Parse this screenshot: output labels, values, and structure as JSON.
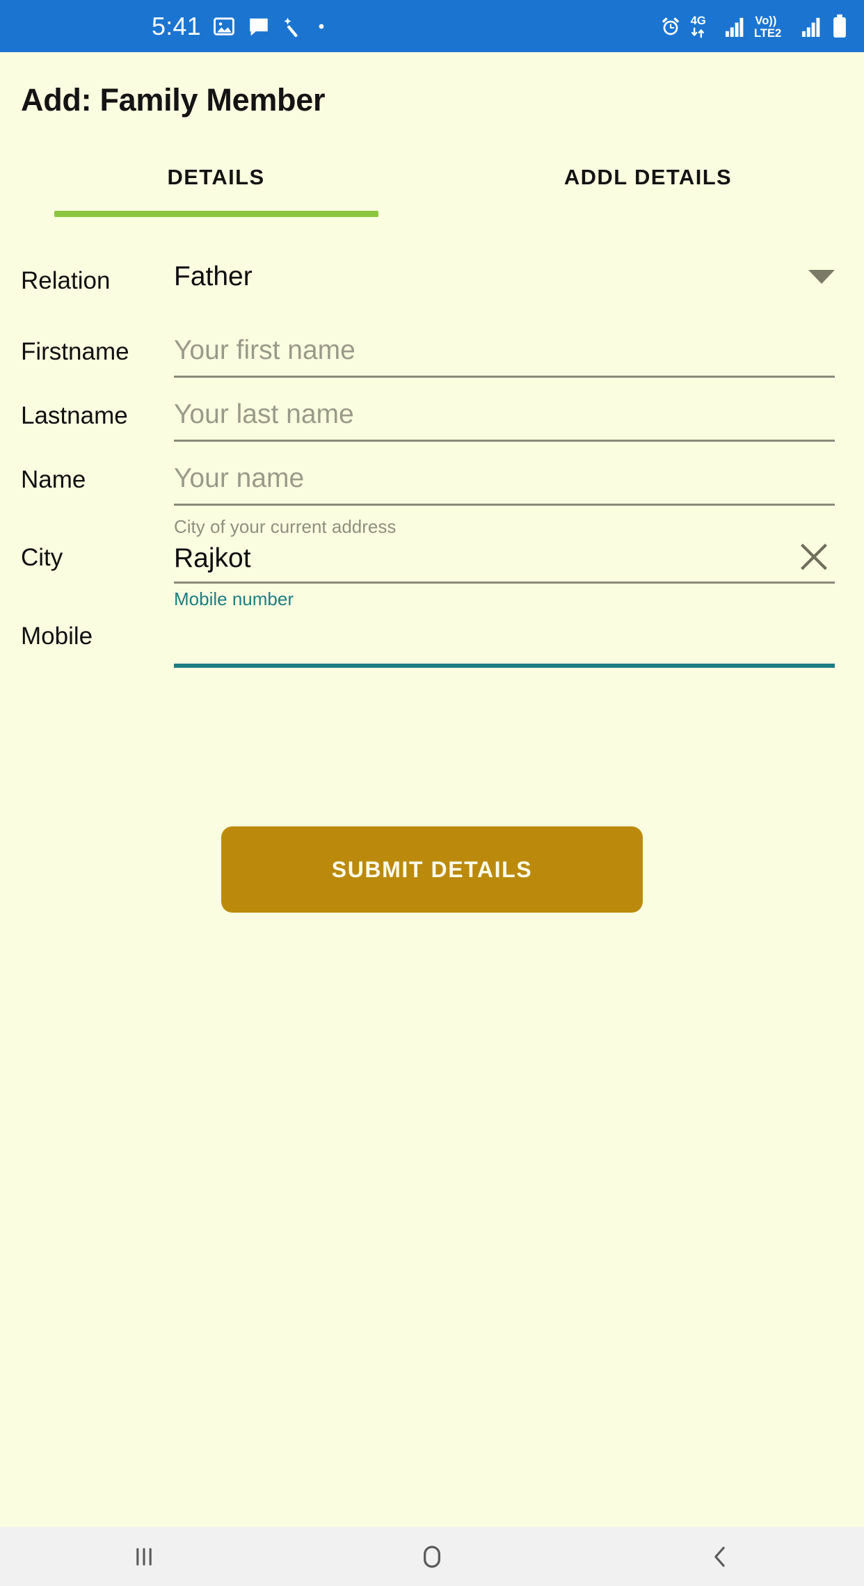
{
  "status_bar": {
    "time": "5:41",
    "background_color": "#1b75d0",
    "left_icons": [
      "image-icon",
      "message-icon",
      "magic-wand-icon",
      "dot-icon"
    ],
    "right_icons": [
      "alarm-icon",
      "network-4g-icon",
      "signal-bars-icon",
      "volte-icon",
      "signal-bars-2-icon",
      "battery-icon"
    ],
    "network_label": "4G",
    "volte_label_top": "Vo))",
    "volte_label_bottom": "LTE2"
  },
  "header": {
    "title": "Add: Family Member"
  },
  "tabs": {
    "active_index": 0,
    "indicator_color": "#8cc63e",
    "items": [
      {
        "label": "DETAILS"
      },
      {
        "label": "ADDL DETAILS"
      }
    ]
  },
  "form": {
    "fields": [
      {
        "label": "Relation",
        "type": "dropdown",
        "value": "Father",
        "helper": "",
        "placeholder": "",
        "focused": false,
        "has_underline": false,
        "has_clear": false
      },
      {
        "label": "Firstname",
        "type": "text",
        "value": "",
        "helper": "",
        "placeholder": "Your first name",
        "focused": false,
        "has_underline": true,
        "has_clear": false
      },
      {
        "label": "Lastname",
        "type": "text",
        "value": "",
        "helper": "",
        "placeholder": "Your last name",
        "focused": false,
        "has_underline": true,
        "has_clear": false
      },
      {
        "label": "Name",
        "type": "text",
        "value": "",
        "helper": "",
        "placeholder": "Your name",
        "focused": false,
        "has_underline": true,
        "has_clear": false
      },
      {
        "label": "City",
        "type": "text",
        "value": "Rajkot",
        "helper": "City of your current address",
        "placeholder": "",
        "focused": false,
        "has_underline": true,
        "has_clear": true
      },
      {
        "label": "Mobile",
        "type": "text",
        "value": "",
        "helper": "Mobile number",
        "placeholder": "",
        "focused": true,
        "has_underline": true,
        "has_clear": false
      }
    ]
  },
  "submit": {
    "label": "SUBMIT DETAILS",
    "background_color": "#bb8a0c"
  },
  "nav_bar": {
    "items": [
      {
        "name": "recents-icon"
      },
      {
        "name": "home-icon"
      },
      {
        "name": "back-icon"
      }
    ]
  },
  "colors": {
    "page_background": "#fbfde0",
    "focus_accent": "#1d7d81",
    "tab_accent": "#8cc63e",
    "submit": "#bb8a0c",
    "status_bar": "#1b75d0"
  }
}
